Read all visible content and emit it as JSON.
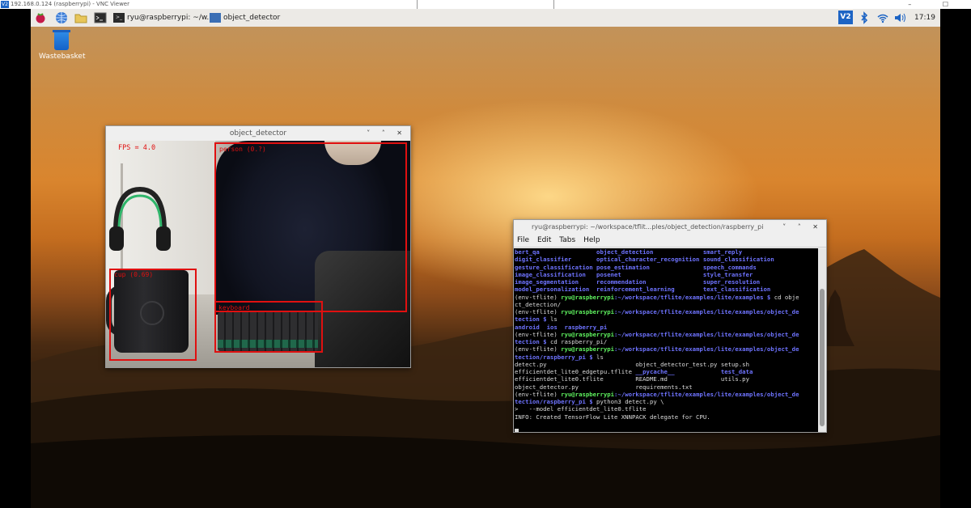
{
  "vnc": {
    "title": "192.168.0.124 (raspberrypi) - VNC Viewer",
    "window_controls": "– ☐"
  },
  "taskbar": {
    "apps": [
      {
        "label": "ryu@raspberrypi: ~/w..."
      },
      {
        "label": "object_detector"
      }
    ],
    "clock": "17:19",
    "vnc_badge": "V2"
  },
  "desktop": {
    "icon_label": "Wastebasket"
  },
  "object_detector": {
    "title": "object_detector",
    "controls": "˅ ˄ ✕",
    "fps": "FPS = 4.0",
    "detections": [
      {
        "label": "person (0.?)"
      },
      {
        "label": "cup (0.69)"
      },
      {
        "label": "keyboard"
      }
    ]
  },
  "terminal": {
    "title": "ryu@raspberrypi: ~/workspace/tflit...ples/object_detection/raspberry_pi",
    "controls": "˅ ˄ ✕",
    "menu": [
      "File",
      "Edit",
      "Tabs",
      "Help"
    ],
    "ls_columns": [
      [
        "bert_qa",
        "object_detection",
        "smart_reply"
      ],
      [
        "digit_classifier",
        "optical_character_recognition",
        "sound_classification"
      ],
      [
        "gesture_classification",
        "pose_estimation",
        "speech_commands"
      ],
      [
        "image_classification",
        "posenet",
        "style_transfer"
      ],
      [
        "image_segmentation",
        "recommendation",
        "super_resolution"
      ],
      [
        "model_personalization",
        "reinforcement_learning",
        "text_classification"
      ]
    ],
    "lines": {
      "l1_env": "(env-tflite) ",
      "l1_user": "ryu@raspberrypi",
      "l1_path": ":~/workspace/tflite/examples/lite/examples $",
      "l1_cmd": " cd obje",
      "l2": "ct_detection/",
      "l3_env": "(env-tflite) ",
      "l3_user": "ryu@raspberrypi",
      "l3_path": ":~/workspace/tflite/examples/lite/examples/object_de",
      "l4_path": "tection $",
      "l4_cmd": " ls",
      "l5_a": "android",
      "l5_b": "ios",
      "l5_c": "raspberry_pi",
      "l6_env": "(env-tflite) ",
      "l6_user": "ryu@raspberrypi",
      "l6_path": ":~/workspace/tflite/examples/lite/examples/object_de",
      "l7_path": "tection $",
      "l7_cmd": " cd raspberry_pi/",
      "l8_env": "(env-tflite) ",
      "l8_user": "ryu@raspberrypi",
      "l8_path": ":~/workspace/tflite/examples/lite/examples/object_de",
      "l9_path": "tection/raspberry_pi $",
      "l9_cmd": " ls",
      "files": [
        [
          "detect.py",
          "object_detector_test.py",
          "setup.sh"
        ],
        [
          "efficientdet_lite0_edgetpu.tflite",
          "__pycache__",
          "test_data"
        ],
        [
          "efficientdet_lite0.tflite",
          "README.md",
          "utils.py"
        ],
        [
          "object_detector.py",
          "requirements.txt",
          ""
        ]
      ],
      "l14_env": "(env-tflite) ",
      "l14_user": "ryu@raspberrypi",
      "l14_path": ":~/workspace/tflite/examples/lite/examples/object_de",
      "l15_path": "tection/raspberry_pi $",
      "l15_cmd": " python3 detect.py \\",
      "l16": ">   --model efficientdet_lite0.tflite",
      "l17": "INFO: Created TensorFlow Lite XNNPACK delegate for CPU."
    }
  }
}
